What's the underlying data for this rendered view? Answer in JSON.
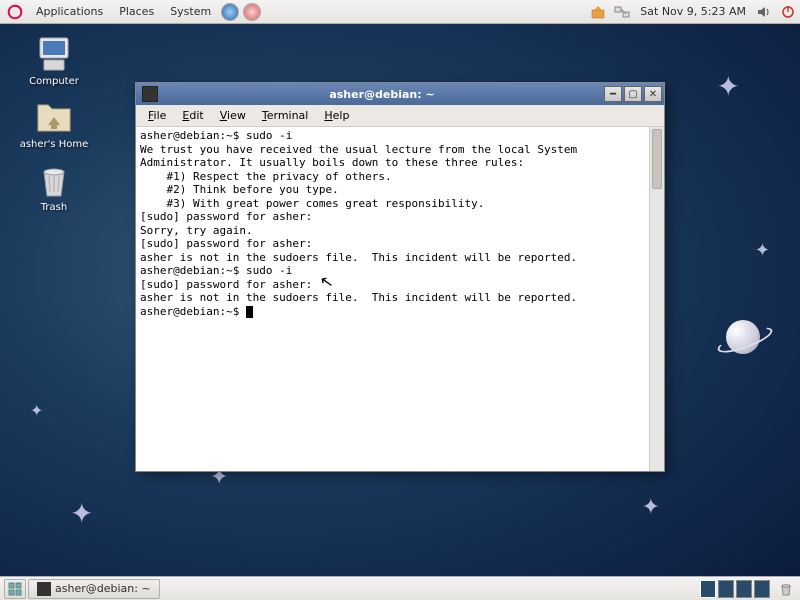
{
  "top_panel": {
    "menus": [
      "Applications",
      "Places",
      "System"
    ],
    "clock": "Sat Nov  9,  5:23 AM"
  },
  "desktop": {
    "icons": [
      {
        "name": "computer",
        "label": "Computer"
      },
      {
        "name": "home",
        "label": "asher's Home"
      },
      {
        "name": "trash",
        "label": "Trash"
      }
    ]
  },
  "terminal": {
    "title": "asher@debian: ~",
    "menus": [
      "File",
      "Edit",
      "View",
      "Terminal",
      "Help"
    ],
    "lines": [
      "asher@debian:~$ sudo -i",
      "",
      "We trust you have received the usual lecture from the local System",
      "Administrator. It usually boils down to these three rules:",
      "",
      "    #1) Respect the privacy of others.",
      "    #2) Think before you type.",
      "    #3) With great power comes great responsibility.",
      "",
      "[sudo] password for asher: ",
      "Sorry, try again.",
      "[sudo] password for asher: ",
      "asher is not in the sudoers file.  This incident will be reported.",
      "asher@debian:~$ sudo -i",
      "[sudo] password for asher: ",
      "asher is not in the sudoers file.  This incident will be reported.",
      "asher@debian:~$ "
    ]
  },
  "bottom_panel": {
    "task_label": "asher@debian: ~"
  }
}
